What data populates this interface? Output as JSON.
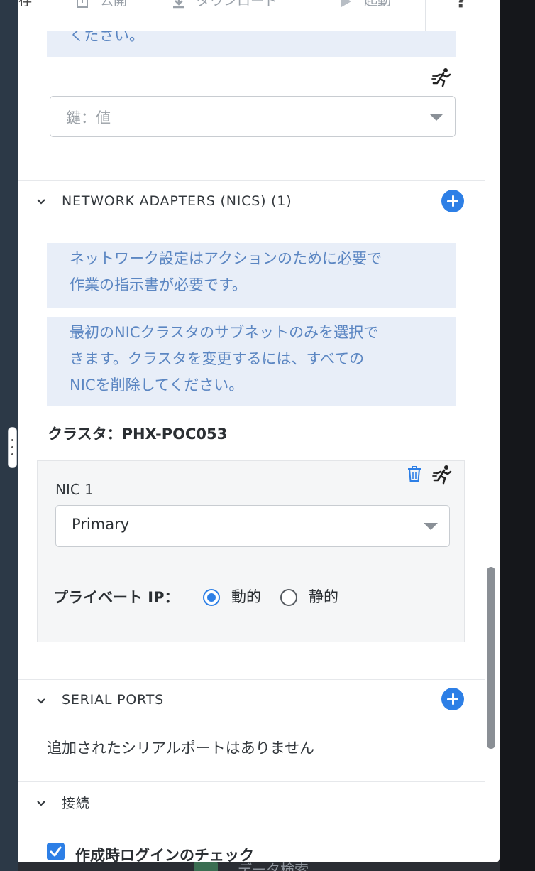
{
  "toolbar": {
    "save": "保存",
    "publish": "公開",
    "download": "ダウンロード",
    "launch": "起動",
    "help": "?"
  },
  "tags": {
    "top_note_tail": "ください。",
    "placeholder": "鍵：値"
  },
  "nics": {
    "header": "NETWORK ADAPTERS (NICS) (1)",
    "info1_line1": "ネットワーク設定はアクションのために必要で",
    "info1_line2": "作業の指示書が必要です。",
    "info2_line1": "最初のNICクラスタのサブネットのみを選択で",
    "info2_line2": "きます。クラスタを変更するには、すべての",
    "info2_line3": "NICを削除してください。",
    "cluster_label": "クラスタ：",
    "cluster_value": "PHX-POC053",
    "nic_title": "NIC 1",
    "nic_network": "Primary",
    "private_ip_label": "プライベート IP：",
    "dynamic_label": "動的",
    "static_label": "静的",
    "selected": "dynamic"
  },
  "serial": {
    "header": "SERIAL PORTS",
    "empty_text": "追加されたシリアルポートはありません"
  },
  "connection": {
    "header": "接続",
    "check_login_label": "作成時ログインのチェック",
    "check_login_checked": true
  },
  "background": {
    "ghost_text": "データ検索"
  },
  "colors": {
    "accent": "#2d7fe6",
    "info_bg": "#e8eef8",
    "info_text": "#5b86c2"
  }
}
